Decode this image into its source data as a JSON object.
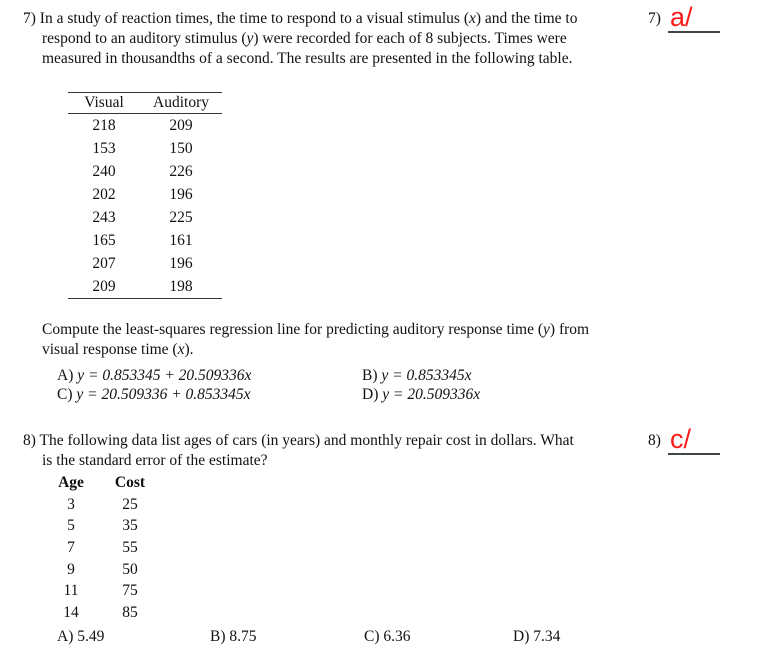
{
  "question7": {
    "number": "7)",
    "lines": [
      "In a study of reaction times, the time to respond to a visual stimulus (x) and the time to",
      "respond to an auditory stimulus (y) were recorded for each of 8 subjects. Times were",
      "measured in thousandths of a second. The results are presented in the following table."
    ],
    "answer_label": "7)",
    "answer_value": "a/",
    "table": {
      "headers": [
        "Visual",
        "Auditory"
      ],
      "rows": [
        [
          "218",
          "209"
        ],
        [
          "153",
          "150"
        ],
        [
          "240",
          "226"
        ],
        [
          "202",
          "196"
        ],
        [
          "243",
          "225"
        ],
        [
          "165",
          "161"
        ],
        [
          "207",
          "196"
        ],
        [
          "209",
          "198"
        ]
      ]
    },
    "prompt_lines": [
      "Compute the least-squares regression line for predicting auditory response time (y) from",
      "visual response time (x)."
    ],
    "choices": [
      {
        "label": "A)",
        "text": "y = 0.853345 + 20.509336x"
      },
      {
        "label": "B)",
        "text": "y = 0.853345x"
      },
      {
        "label": "C)",
        "text": "y = 20.509336 + 0.853345x"
      },
      {
        "label": "D)",
        "text": "y = 20.509336x"
      }
    ]
  },
  "question8": {
    "number": "8)",
    "lines": [
      "The following data list ages of cars (in years) and monthly repair cost in dollars.  What",
      "is the standard error of the estimate?"
    ],
    "answer_label": "8)",
    "answer_value": "c/",
    "table": {
      "headers": [
        "Age",
        "Cost"
      ],
      "rows": [
        [
          "3",
          "25"
        ],
        [
          "5",
          "35"
        ],
        [
          "7",
          "55"
        ],
        [
          "9",
          "50"
        ],
        [
          "11",
          "75"
        ],
        [
          "14",
          "85"
        ]
      ]
    },
    "choices": [
      {
        "label": "A)",
        "text": "5.49"
      },
      {
        "label": "B)",
        "text": "8.75"
      },
      {
        "label": "C)",
        "text": "6.36"
      },
      {
        "label": "D)",
        "text": "7.34"
      }
    ]
  },
  "colors": {
    "answer_mark": "#ff1a1a",
    "text": "#111111"
  }
}
